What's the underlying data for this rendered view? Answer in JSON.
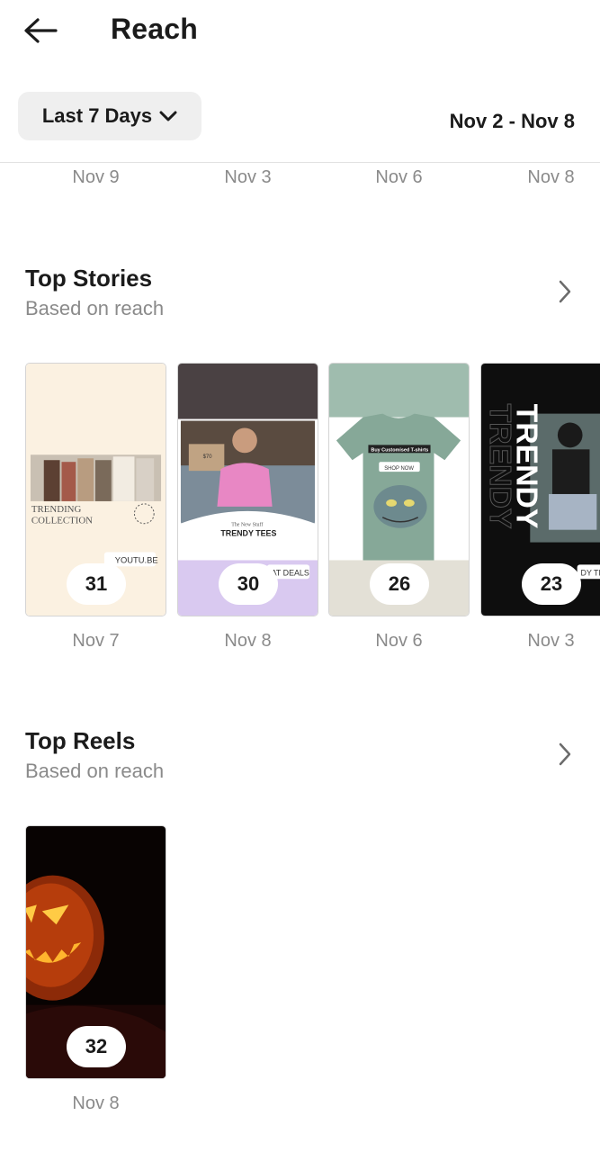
{
  "header": {
    "title": "Reach"
  },
  "filter": {
    "range_label": "Last 7 Days",
    "date_range": "Nov 2 - Nov 8"
  },
  "top_date_row": [
    "Nov 9",
    "Nov 3",
    "Nov 6",
    "Nov 8"
  ],
  "top_stories": {
    "title": "Top Stories",
    "subtitle": "Based on reach",
    "items": [
      {
        "count": "31",
        "date": "Nov 7",
        "text_1": "TRENDING",
        "text_2": "COLLECTION",
        "text_3": "YOUTU.BE"
      },
      {
        "count": "30",
        "date": "Nov 8",
        "text_1": "The New Stuff",
        "text_2": "TRENDY TEES",
        "text_3": "AT DEALS",
        "text_4": "$70"
      },
      {
        "count": "26",
        "date": "Nov 6",
        "text_1": "Buy Customised T-shirts",
        "text_2": "SHOP NOW"
      },
      {
        "count": "23",
        "date": "Nov 3",
        "text_1": "TRENDY",
        "text_2": "TRENDY",
        "text_3": "DY TE"
      }
    ]
  },
  "top_reels": {
    "title": "Top Reels",
    "subtitle": "Based on reach",
    "items": [
      {
        "count": "32",
        "date": "Nov 8"
      }
    ]
  },
  "colors": {
    "accent_text": "#1b1b1b",
    "muted_text": "#8a8a8a",
    "chip_bg": "#efefef"
  },
  "icons": {
    "back": "arrow-left-icon",
    "dropdown": "chevron-down-icon",
    "more": "chevron-right-icon"
  }
}
